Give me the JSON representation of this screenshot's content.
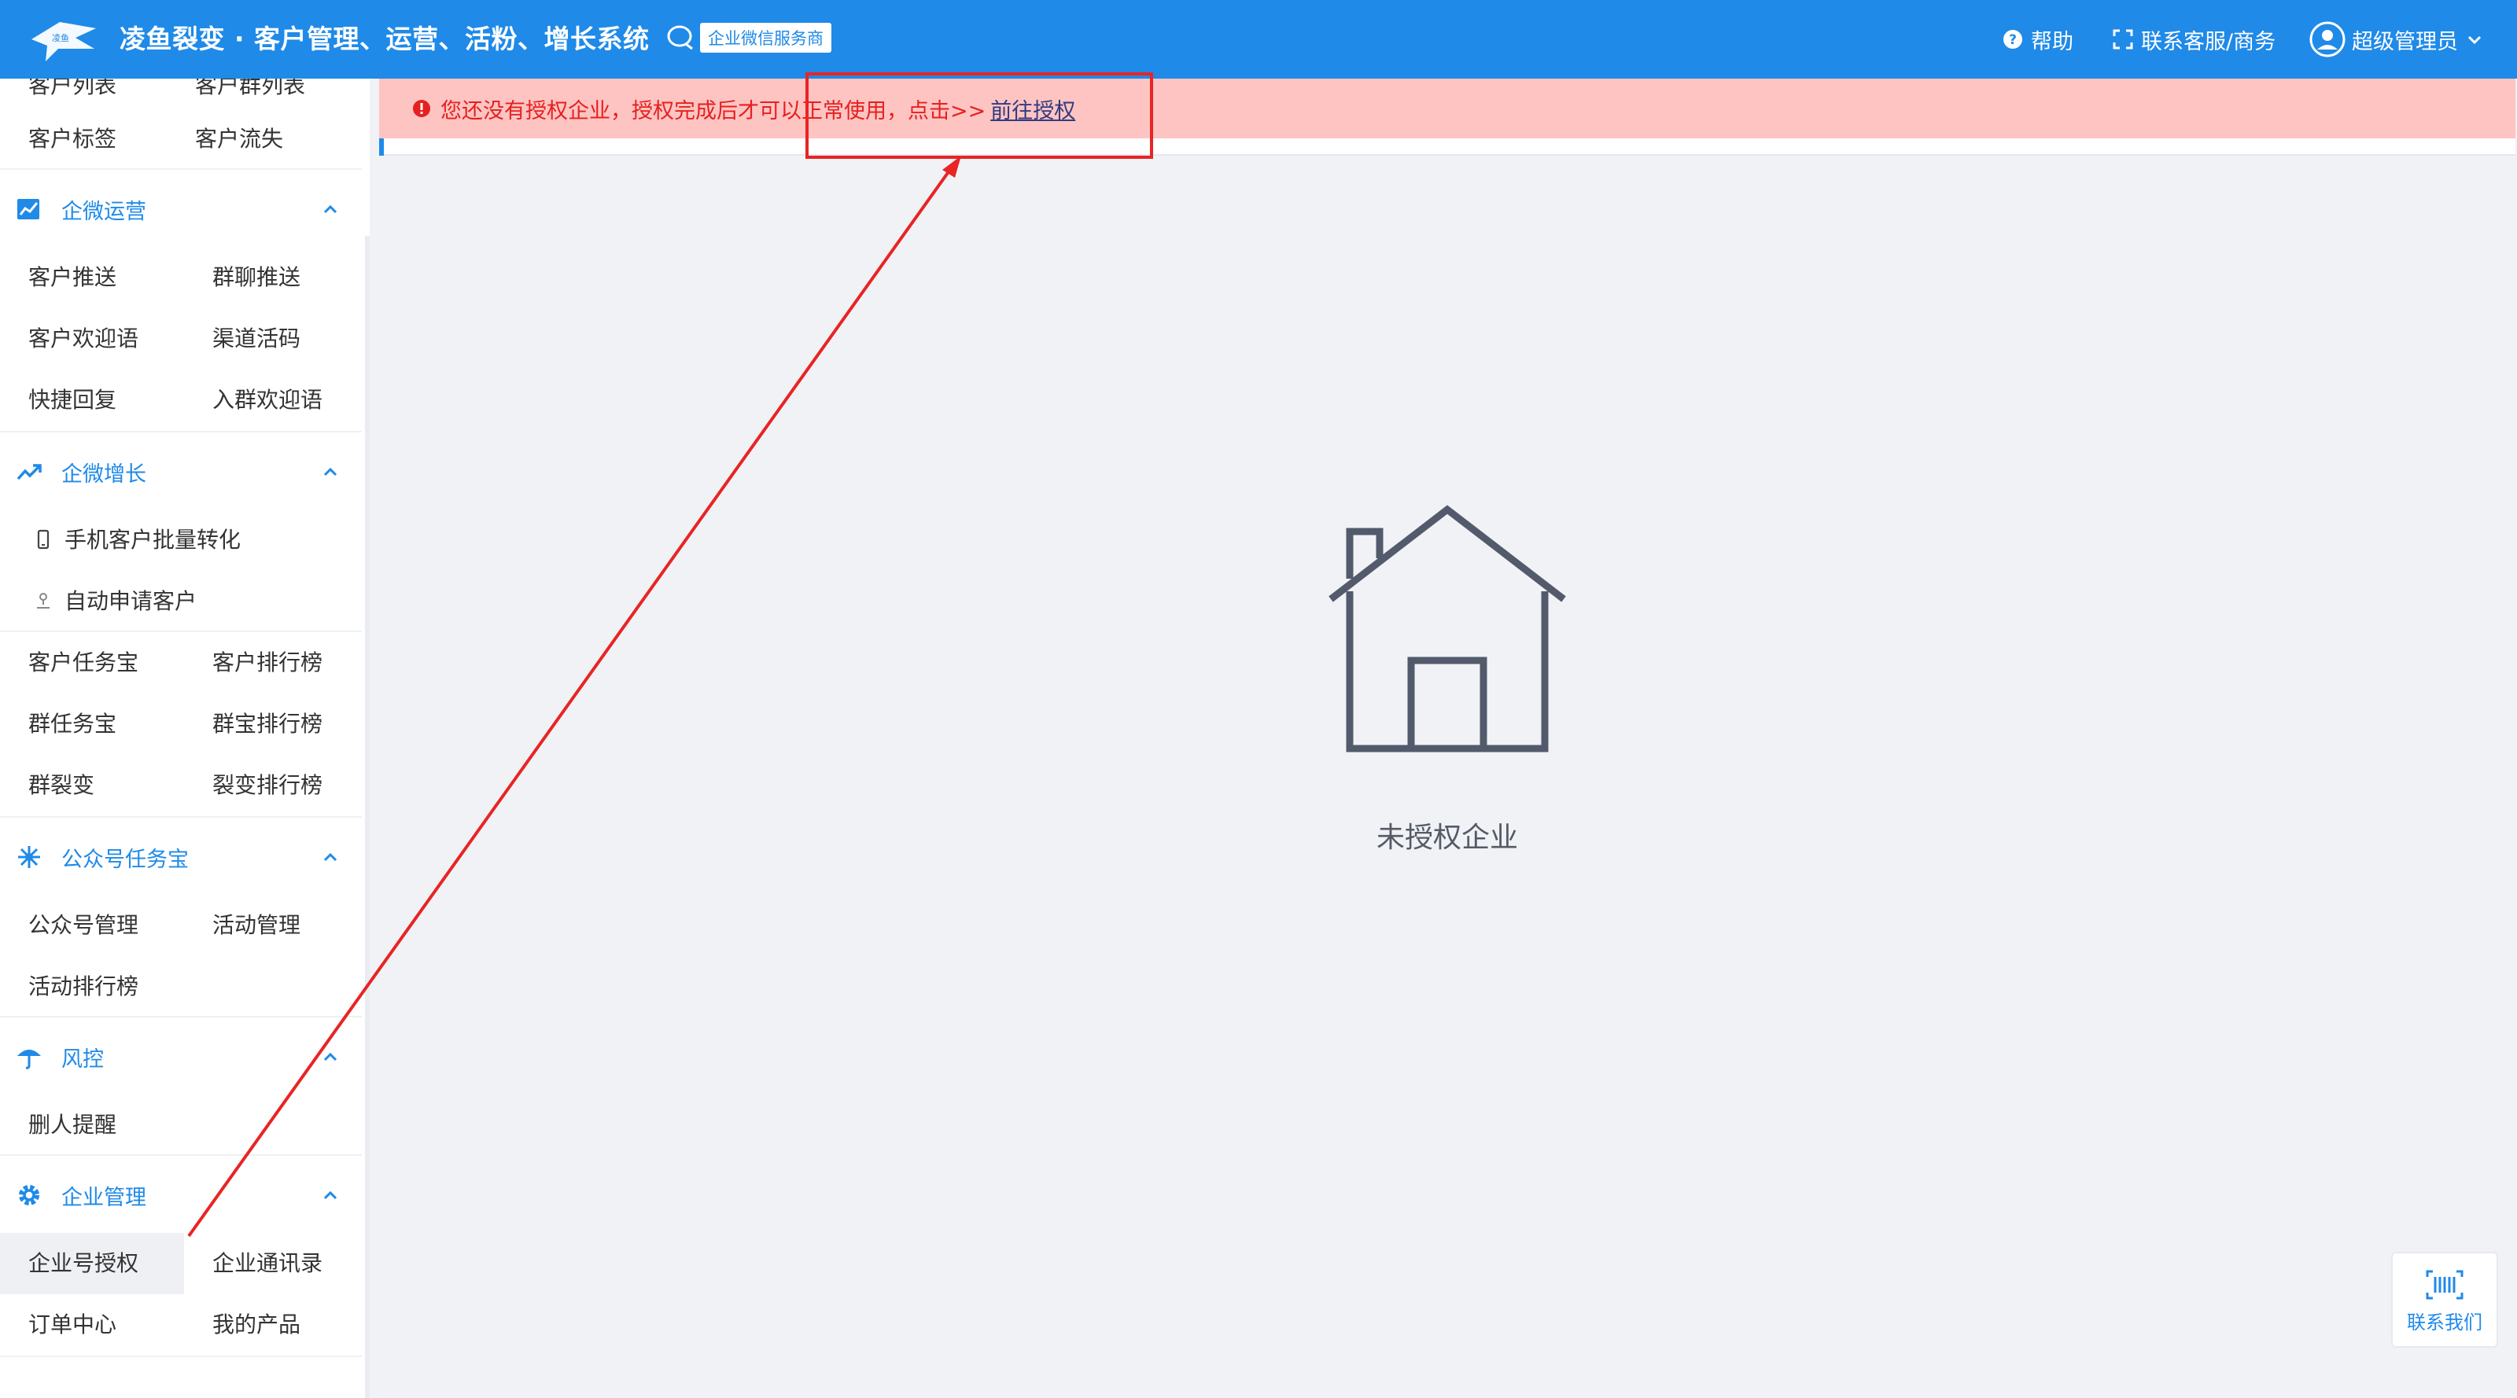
{
  "header": {
    "logo_text": "凌鱼",
    "title": "凌鱼裂变 · 客户管理、运营、活粉、增长系统",
    "provider_badge": "企业微信服务商",
    "help": "帮助",
    "contact": "联系客服/商务",
    "user": "超级管理员"
  },
  "sidebar": {
    "top_partial": {
      "left": "客户列表",
      "right": "客户群列表"
    },
    "top_items": [
      {
        "label": "客户标签"
      },
      {
        "label": "客户流失"
      }
    ],
    "sections": [
      {
        "title": "企微运营",
        "icon": "chart-icon",
        "items": [
          "客户推送",
          "群聊推送",
          "客户欢迎语",
          "渠道活码",
          "快捷回复",
          "入群欢迎语"
        ]
      },
      {
        "title": "企微增长",
        "icon": "trend-icon",
        "single_items": [
          "手机客户批量转化",
          "自动申请客户"
        ],
        "items": [
          "客户任务宝",
          "客户排行榜",
          "群任务宝",
          "群宝排行榜",
          "群裂变",
          "裂变排行榜"
        ]
      },
      {
        "title": "公众号任务宝",
        "icon": "snowflake-icon",
        "items": [
          "公众号管理",
          "活动管理",
          "活动排行榜"
        ]
      },
      {
        "title": "风控",
        "icon": "umbrella-icon",
        "items": [
          "删人提醒"
        ]
      },
      {
        "title": "企业管理",
        "icon": "gear-icon",
        "items": [
          "企业号授权",
          "企业通讯录",
          "订单中心",
          "我的产品"
        ],
        "active": "企业号授权"
      }
    ]
  },
  "alert": {
    "text": "您还没有授权企业，授权完成后才可以正常使用，点击>>",
    "link": "前往授权"
  },
  "empty_state": {
    "text": "未授权企业",
    "icon": "house-icon"
  },
  "float_button": {
    "label": "联系我们",
    "icon": "barcode-icon"
  },
  "colors": {
    "primary": "#1f8ae8",
    "alert_bg": "#fec4c2",
    "alert_text": "#e52020",
    "annotation": "#e82424"
  }
}
